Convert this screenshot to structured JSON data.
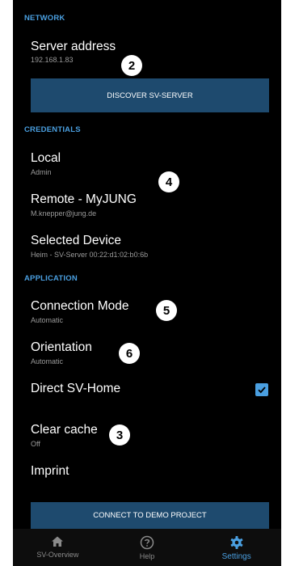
{
  "sections": {
    "network": "NETWORK",
    "credentials": "CREDENTIALS",
    "application": "APPLICATION"
  },
  "server": {
    "title": "Server address",
    "value": "192.168.1.83"
  },
  "discover_button": "DISCOVER SV-SERVER",
  "local": {
    "title": "Local",
    "value": "Admin"
  },
  "remote": {
    "title": "Remote - MyJUNG",
    "value": "M.knepper@jung.de"
  },
  "selected_device": {
    "title": "Selected Device",
    "value": "Heim - SV-Server 00:22:d1:02:b0:6b"
  },
  "connection_mode": {
    "title": "Connection Mode",
    "value": "Automatic"
  },
  "orientation": {
    "title": "Orientation",
    "value": "Automatic"
  },
  "direct_sv_home": {
    "title": "Direct SV-Home",
    "checked": true
  },
  "clear_cache": {
    "title": "Clear cache",
    "value": "Off"
  },
  "imprint": {
    "title": "Imprint"
  },
  "demo_button": "CONNECT TO DEMO PROJECT",
  "badges": {
    "b2": "2",
    "b4": "4",
    "b5": "5",
    "b6": "6",
    "b3": "3"
  },
  "nav": {
    "overview": {
      "label": "SV-Overview",
      "icon": "home-icon"
    },
    "help": {
      "label": "Help",
      "icon": "help-icon"
    },
    "settings": {
      "label": "Settings",
      "icon": "gear-icon",
      "active": true
    }
  },
  "colors": {
    "accent": "#4a9fe0",
    "button": "#1e4a6e",
    "background": "#000000"
  }
}
